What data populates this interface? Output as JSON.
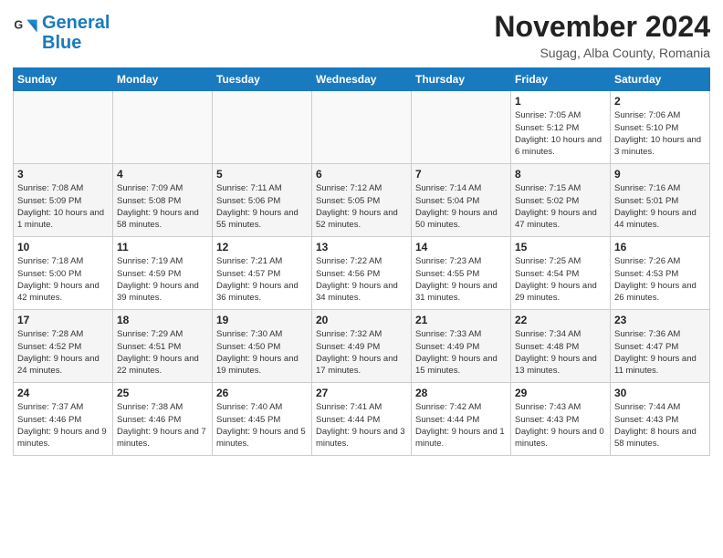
{
  "logo": {
    "text_general": "General",
    "text_blue": "Blue"
  },
  "header": {
    "month_title": "November 2024",
    "location": "Sugag, Alba County, Romania"
  },
  "days_of_week": [
    "Sunday",
    "Monday",
    "Tuesday",
    "Wednesday",
    "Thursday",
    "Friday",
    "Saturday"
  ],
  "weeks": [
    [
      {
        "day": "",
        "info": ""
      },
      {
        "day": "",
        "info": ""
      },
      {
        "day": "",
        "info": ""
      },
      {
        "day": "",
        "info": ""
      },
      {
        "day": "",
        "info": ""
      },
      {
        "day": "1",
        "info": "Sunrise: 7:05 AM\nSunset: 5:12 PM\nDaylight: 10 hours and 6 minutes."
      },
      {
        "day": "2",
        "info": "Sunrise: 7:06 AM\nSunset: 5:10 PM\nDaylight: 10 hours and 3 minutes."
      }
    ],
    [
      {
        "day": "3",
        "info": "Sunrise: 7:08 AM\nSunset: 5:09 PM\nDaylight: 10 hours and 1 minute."
      },
      {
        "day": "4",
        "info": "Sunrise: 7:09 AM\nSunset: 5:08 PM\nDaylight: 9 hours and 58 minutes."
      },
      {
        "day": "5",
        "info": "Sunrise: 7:11 AM\nSunset: 5:06 PM\nDaylight: 9 hours and 55 minutes."
      },
      {
        "day": "6",
        "info": "Sunrise: 7:12 AM\nSunset: 5:05 PM\nDaylight: 9 hours and 52 minutes."
      },
      {
        "day": "7",
        "info": "Sunrise: 7:14 AM\nSunset: 5:04 PM\nDaylight: 9 hours and 50 minutes."
      },
      {
        "day": "8",
        "info": "Sunrise: 7:15 AM\nSunset: 5:02 PM\nDaylight: 9 hours and 47 minutes."
      },
      {
        "day": "9",
        "info": "Sunrise: 7:16 AM\nSunset: 5:01 PM\nDaylight: 9 hours and 44 minutes."
      }
    ],
    [
      {
        "day": "10",
        "info": "Sunrise: 7:18 AM\nSunset: 5:00 PM\nDaylight: 9 hours and 42 minutes."
      },
      {
        "day": "11",
        "info": "Sunrise: 7:19 AM\nSunset: 4:59 PM\nDaylight: 9 hours and 39 minutes."
      },
      {
        "day": "12",
        "info": "Sunrise: 7:21 AM\nSunset: 4:57 PM\nDaylight: 9 hours and 36 minutes."
      },
      {
        "day": "13",
        "info": "Sunrise: 7:22 AM\nSunset: 4:56 PM\nDaylight: 9 hours and 34 minutes."
      },
      {
        "day": "14",
        "info": "Sunrise: 7:23 AM\nSunset: 4:55 PM\nDaylight: 9 hours and 31 minutes."
      },
      {
        "day": "15",
        "info": "Sunrise: 7:25 AM\nSunset: 4:54 PM\nDaylight: 9 hours and 29 minutes."
      },
      {
        "day": "16",
        "info": "Sunrise: 7:26 AM\nSunset: 4:53 PM\nDaylight: 9 hours and 26 minutes."
      }
    ],
    [
      {
        "day": "17",
        "info": "Sunrise: 7:28 AM\nSunset: 4:52 PM\nDaylight: 9 hours and 24 minutes."
      },
      {
        "day": "18",
        "info": "Sunrise: 7:29 AM\nSunset: 4:51 PM\nDaylight: 9 hours and 22 minutes."
      },
      {
        "day": "19",
        "info": "Sunrise: 7:30 AM\nSunset: 4:50 PM\nDaylight: 9 hours and 19 minutes."
      },
      {
        "day": "20",
        "info": "Sunrise: 7:32 AM\nSunset: 4:49 PM\nDaylight: 9 hours and 17 minutes."
      },
      {
        "day": "21",
        "info": "Sunrise: 7:33 AM\nSunset: 4:49 PM\nDaylight: 9 hours and 15 minutes."
      },
      {
        "day": "22",
        "info": "Sunrise: 7:34 AM\nSunset: 4:48 PM\nDaylight: 9 hours and 13 minutes."
      },
      {
        "day": "23",
        "info": "Sunrise: 7:36 AM\nSunset: 4:47 PM\nDaylight: 9 hours and 11 minutes."
      }
    ],
    [
      {
        "day": "24",
        "info": "Sunrise: 7:37 AM\nSunset: 4:46 PM\nDaylight: 9 hours and 9 minutes."
      },
      {
        "day": "25",
        "info": "Sunrise: 7:38 AM\nSunset: 4:46 PM\nDaylight: 9 hours and 7 minutes."
      },
      {
        "day": "26",
        "info": "Sunrise: 7:40 AM\nSunset: 4:45 PM\nDaylight: 9 hours and 5 minutes."
      },
      {
        "day": "27",
        "info": "Sunrise: 7:41 AM\nSunset: 4:44 PM\nDaylight: 9 hours and 3 minutes."
      },
      {
        "day": "28",
        "info": "Sunrise: 7:42 AM\nSunset: 4:44 PM\nDaylight: 9 hours and 1 minute."
      },
      {
        "day": "29",
        "info": "Sunrise: 7:43 AM\nSunset: 4:43 PM\nDaylight: 9 hours and 0 minutes."
      },
      {
        "day": "30",
        "info": "Sunrise: 7:44 AM\nSunset: 4:43 PM\nDaylight: 8 hours and 58 minutes."
      }
    ]
  ]
}
